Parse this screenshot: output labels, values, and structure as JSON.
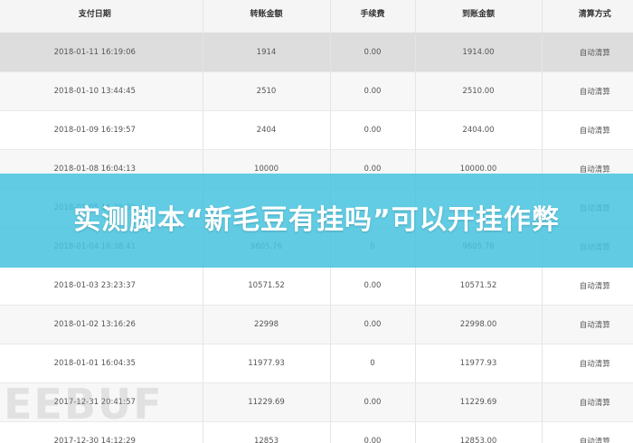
{
  "table": {
    "headers": [
      "支付日期",
      "转账金额",
      "手续费",
      "到账金额",
      "清算方式"
    ],
    "rows": [
      [
        "2018-01-11 16:19:06",
        "1914",
        "0.00",
        "1914.00",
        "自动清算"
      ],
      [
        "2018-01-10 13:44:45",
        "2510",
        "0.00",
        "2510.00",
        "自动清算"
      ],
      [
        "2018-01-09 16:19:57",
        "2404",
        "0.00",
        "2404.00",
        "自动清算"
      ],
      [
        "2018-01-08 16:04:13",
        "10000",
        "0.00",
        "10000.00",
        "自动清算"
      ],
      [
        "2018-01-05 16:29:09",
        "",
        "",
        "",
        "自动清算"
      ],
      [
        "2018-01-04 16:38:41",
        "9605.76",
        "0",
        "9605.76",
        "自动清算"
      ],
      [
        "2018-01-03 23:23:37",
        "10571.52",
        "0.00",
        "10571.52",
        "自动清算"
      ],
      [
        "2018-01-02 13:16:26",
        "22998",
        "0.00",
        "22998.00",
        "自动清算"
      ],
      [
        "2018-01-01 16:04:35",
        "11977.93",
        "0",
        "11977.93",
        "自动清算"
      ],
      [
        "2017-12-31 20:41:57",
        "11229.69",
        "0.00",
        "11229.69",
        "自动清算"
      ],
      [
        "2017-12-30 14:12:29",
        "12853",
        "0.00",
        "12853.00",
        "自动清算"
      ]
    ]
  },
  "banner": {
    "text": "实测脚本“新毛豆有挂吗”可以开挂作弊"
  },
  "watermark": {
    "text": "EEBUF"
  },
  "colors": {
    "banner": "#47c4e0",
    "header_bg": "#f5f5f5",
    "highlight_row": "#dddddd"
  }
}
